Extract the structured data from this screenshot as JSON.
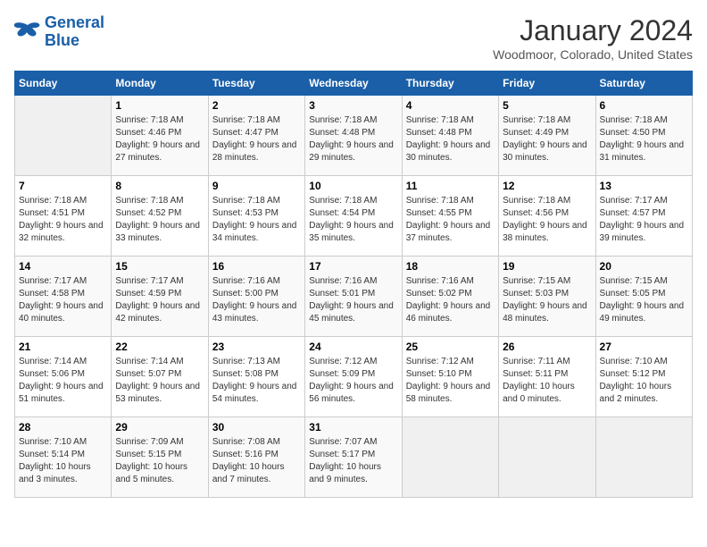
{
  "header": {
    "logo_line1": "General",
    "logo_line2": "Blue",
    "title": "January 2024",
    "subtitle": "Woodmoor, Colorado, United States"
  },
  "weekdays": [
    "Sunday",
    "Monday",
    "Tuesday",
    "Wednesday",
    "Thursday",
    "Friday",
    "Saturday"
  ],
  "weeks": [
    [
      {
        "day": "",
        "sunrise": "",
        "sunset": "",
        "daylight": ""
      },
      {
        "day": "1",
        "sunrise": "7:18 AM",
        "sunset": "4:46 PM",
        "daylight": "9 hours and 27 minutes."
      },
      {
        "day": "2",
        "sunrise": "7:18 AM",
        "sunset": "4:47 PM",
        "daylight": "9 hours and 28 minutes."
      },
      {
        "day": "3",
        "sunrise": "7:18 AM",
        "sunset": "4:48 PM",
        "daylight": "9 hours and 29 minutes."
      },
      {
        "day": "4",
        "sunrise": "7:18 AM",
        "sunset": "4:48 PM",
        "daylight": "9 hours and 30 minutes."
      },
      {
        "day": "5",
        "sunrise": "7:18 AM",
        "sunset": "4:49 PM",
        "daylight": "9 hours and 30 minutes."
      },
      {
        "day": "6",
        "sunrise": "7:18 AM",
        "sunset": "4:50 PM",
        "daylight": "9 hours and 31 minutes."
      }
    ],
    [
      {
        "day": "7",
        "sunrise": "7:18 AM",
        "sunset": "4:51 PM",
        "daylight": "9 hours and 32 minutes."
      },
      {
        "day": "8",
        "sunrise": "7:18 AM",
        "sunset": "4:52 PM",
        "daylight": "9 hours and 33 minutes."
      },
      {
        "day": "9",
        "sunrise": "7:18 AM",
        "sunset": "4:53 PM",
        "daylight": "9 hours and 34 minutes."
      },
      {
        "day": "10",
        "sunrise": "7:18 AM",
        "sunset": "4:54 PM",
        "daylight": "9 hours and 35 minutes."
      },
      {
        "day": "11",
        "sunrise": "7:18 AM",
        "sunset": "4:55 PM",
        "daylight": "9 hours and 37 minutes."
      },
      {
        "day": "12",
        "sunrise": "7:18 AM",
        "sunset": "4:56 PM",
        "daylight": "9 hours and 38 minutes."
      },
      {
        "day": "13",
        "sunrise": "7:17 AM",
        "sunset": "4:57 PM",
        "daylight": "9 hours and 39 minutes."
      }
    ],
    [
      {
        "day": "14",
        "sunrise": "7:17 AM",
        "sunset": "4:58 PM",
        "daylight": "9 hours and 40 minutes."
      },
      {
        "day": "15",
        "sunrise": "7:17 AM",
        "sunset": "4:59 PM",
        "daylight": "9 hours and 42 minutes."
      },
      {
        "day": "16",
        "sunrise": "7:16 AM",
        "sunset": "5:00 PM",
        "daylight": "9 hours and 43 minutes."
      },
      {
        "day": "17",
        "sunrise": "7:16 AM",
        "sunset": "5:01 PM",
        "daylight": "9 hours and 45 minutes."
      },
      {
        "day": "18",
        "sunrise": "7:16 AM",
        "sunset": "5:02 PM",
        "daylight": "9 hours and 46 minutes."
      },
      {
        "day": "19",
        "sunrise": "7:15 AM",
        "sunset": "5:03 PM",
        "daylight": "9 hours and 48 minutes."
      },
      {
        "day": "20",
        "sunrise": "7:15 AM",
        "sunset": "5:05 PM",
        "daylight": "9 hours and 49 minutes."
      }
    ],
    [
      {
        "day": "21",
        "sunrise": "7:14 AM",
        "sunset": "5:06 PM",
        "daylight": "9 hours and 51 minutes."
      },
      {
        "day": "22",
        "sunrise": "7:14 AM",
        "sunset": "5:07 PM",
        "daylight": "9 hours and 53 minutes."
      },
      {
        "day": "23",
        "sunrise": "7:13 AM",
        "sunset": "5:08 PM",
        "daylight": "9 hours and 54 minutes."
      },
      {
        "day": "24",
        "sunrise": "7:12 AM",
        "sunset": "5:09 PM",
        "daylight": "9 hours and 56 minutes."
      },
      {
        "day": "25",
        "sunrise": "7:12 AM",
        "sunset": "5:10 PM",
        "daylight": "9 hours and 58 minutes."
      },
      {
        "day": "26",
        "sunrise": "7:11 AM",
        "sunset": "5:11 PM",
        "daylight": "10 hours and 0 minutes."
      },
      {
        "day": "27",
        "sunrise": "7:10 AM",
        "sunset": "5:12 PM",
        "daylight": "10 hours and 2 minutes."
      }
    ],
    [
      {
        "day": "28",
        "sunrise": "7:10 AM",
        "sunset": "5:14 PM",
        "daylight": "10 hours and 3 minutes."
      },
      {
        "day": "29",
        "sunrise": "7:09 AM",
        "sunset": "5:15 PM",
        "daylight": "10 hours and 5 minutes."
      },
      {
        "day": "30",
        "sunrise": "7:08 AM",
        "sunset": "5:16 PM",
        "daylight": "10 hours and 7 minutes."
      },
      {
        "day": "31",
        "sunrise": "7:07 AM",
        "sunset": "5:17 PM",
        "daylight": "10 hours and 9 minutes."
      },
      {
        "day": "",
        "sunrise": "",
        "sunset": "",
        "daylight": ""
      },
      {
        "day": "",
        "sunrise": "",
        "sunset": "",
        "daylight": ""
      },
      {
        "day": "",
        "sunrise": "",
        "sunset": "",
        "daylight": ""
      }
    ]
  ],
  "labels": {
    "sunrise_prefix": "Sunrise: ",
    "sunset_prefix": "Sunset: ",
    "daylight_prefix": "Daylight: "
  }
}
